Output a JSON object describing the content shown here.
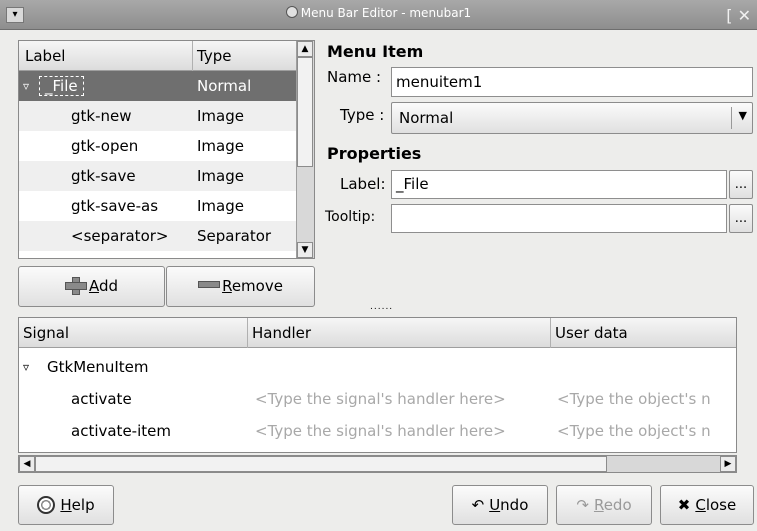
{
  "window": {
    "title": "Menu Bar Editor - menubar1",
    "menu_icon": "▾",
    "close": "[ ✕"
  },
  "menu_tree": {
    "headers": {
      "label": "Label",
      "type": "Type"
    },
    "rows": [
      {
        "expander": "▿",
        "label": "_File",
        "type": "Normal"
      },
      {
        "label": "gtk-new",
        "type": "Image"
      },
      {
        "label": "gtk-open",
        "type": "Image"
      },
      {
        "label": "gtk-save",
        "type": "Image"
      },
      {
        "label": "gtk-save-as",
        "type": "Image"
      },
      {
        "label": "<separator>",
        "type": "Separator"
      }
    ]
  },
  "buttons": {
    "add": {
      "accel": "A",
      "rest": "dd"
    },
    "remove": {
      "accel": "R",
      "rest": "emove"
    },
    "help": {
      "accel": "H",
      "rest": "elp"
    },
    "undo": {
      "accel": "U",
      "rest": "ndo"
    },
    "redo": {
      "accel": "R",
      "rest": "edo"
    },
    "close": {
      "accel": "C",
      "rest": "lose"
    }
  },
  "menu_item": {
    "heading": "Menu Item",
    "name_label": "Name :",
    "name_value": "menuitem1",
    "type_label": "Type :",
    "type_value": "Normal"
  },
  "properties": {
    "heading": "Properties",
    "label_label": "Label:",
    "label_value": "_File",
    "tooltip_label": "Tooltip:",
    "tooltip_value": "",
    "ellipsis": "..."
  },
  "pane_handle": "......",
  "signals": {
    "headers": {
      "signal": "Signal",
      "handler": "Handler",
      "user_data": "User data"
    },
    "group": {
      "expander": "▿",
      "name": "GtkMenuItem"
    },
    "rows": [
      {
        "signal": "activate",
        "handler": "<Type the signal's handler here>",
        "user_data": "<Type the object's n"
      },
      {
        "signal": "activate-item",
        "handler": "<Type the signal's handler here>",
        "user_data": "<Type the object's n"
      }
    ]
  },
  "colors": {
    "selected_row": "#6f6f6f",
    "alt_row": "#efefef",
    "titlebar": "#9c9c9c"
  },
  "icons": [
    "window-menu-icon",
    "app-icon",
    "plus-icon",
    "minus-icon",
    "help-icon",
    "undo-icon",
    "redo-icon",
    "close-icon",
    "scroll-up-icon",
    "scroll-down-icon",
    "scroll-left-icon",
    "scroll-right-icon",
    "dropdown-arrow-icon"
  ]
}
